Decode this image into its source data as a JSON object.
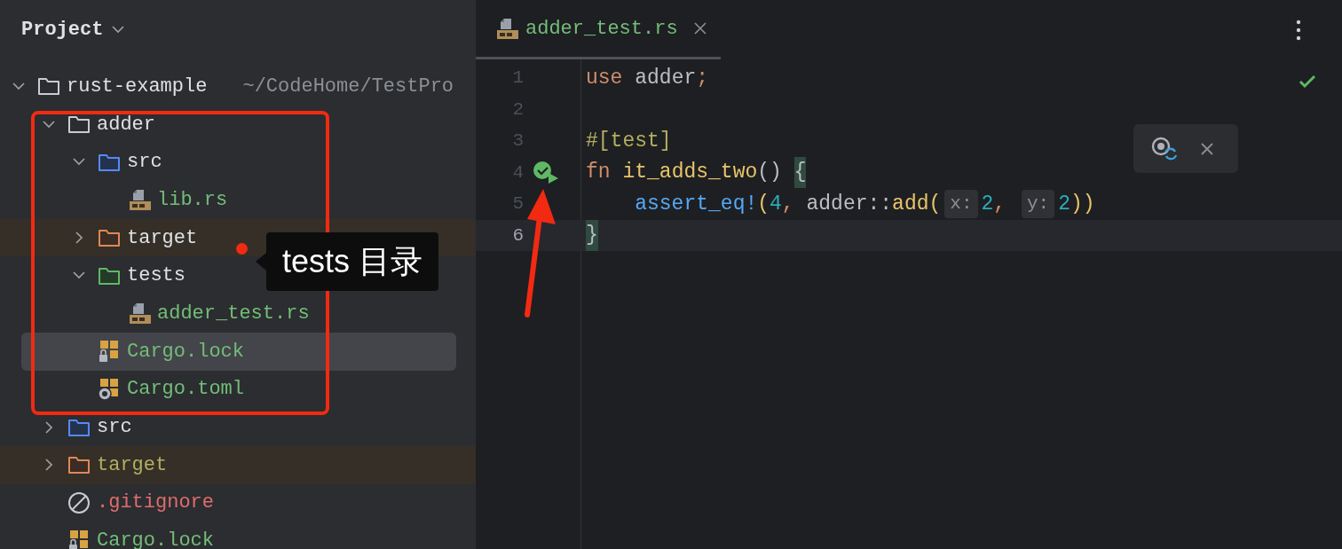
{
  "project_panel": {
    "title": "Project",
    "tree": [
      {
        "name": "rust-example",
        "kind": "folder",
        "color": "#dfe1e5",
        "path": "~/CodeHome/TestPro",
        "expanded": true,
        "selected": false,
        "excluded": false,
        "children": [
          {
            "name": "adder",
            "kind": "folder",
            "color": "#dfe1e5",
            "expanded": true,
            "selected": false,
            "excluded": false,
            "children": [
              {
                "name": "src",
                "kind": "source_folder",
                "color": "#dfe1e5",
                "expanded": true,
                "selected": false,
                "excluded": false,
                "children": [
                  {
                    "name": "lib.rs",
                    "kind": "rs_file",
                    "color": "#73bd79",
                    "selected": false,
                    "excluded": false
                  }
                ]
              },
              {
                "name": "target",
                "kind": "excluded_folder",
                "color": "#dfe1e5",
                "expanded": false,
                "selected": false,
                "excluded": true
              },
              {
                "name": "tests",
                "kind": "test_folder",
                "color": "#dfe1e5",
                "expanded": true,
                "selected": false,
                "excluded": false,
                "children": [
                  {
                    "name": "adder_test.rs",
                    "kind": "rs_file",
                    "color": "#73bd79",
                    "selected": false,
                    "excluded": false
                  }
                ]
              },
              {
                "name": "Cargo.lock",
                "kind": "cargo_lock",
                "color": "#73bd79",
                "selected": true,
                "excluded": false
              },
              {
                "name": "Cargo.toml",
                "kind": "cargo_toml",
                "color": "#73bd79",
                "selected": false,
                "excluded": false
              }
            ]
          },
          {
            "name": "src",
            "kind": "source_folder",
            "color": "#dfe1e5",
            "expanded": false,
            "selected": false,
            "excluded": false
          },
          {
            "name": "target",
            "kind": "excluded_folder",
            "color": "#b3ae60",
            "expanded": false,
            "selected": false,
            "excluded": true
          },
          {
            "name": ".gitignore",
            "kind": "ignore_file",
            "color": "#e06c6c",
            "selected": false,
            "excluded": false
          },
          {
            "name": "Cargo.lock",
            "kind": "cargo_lock",
            "color": "#73bd79",
            "selected": false,
            "excluded": false
          }
        ]
      }
    ]
  },
  "annotation": {
    "label": "tests 目录"
  },
  "editor": {
    "tab": {
      "label": "adder_test.rs",
      "selected": true
    },
    "lines": [
      {
        "number": "1",
        "current": false,
        "run_marker": false,
        "tokens": [
          {
            "text": "use ",
            "kind": "keyword"
          },
          {
            "text": "adder",
            "kind": "ident"
          },
          {
            "text": ";",
            "kind": "keyword"
          }
        ]
      },
      {
        "number": "2",
        "current": false,
        "run_marker": false
      },
      {
        "number": "3",
        "current": false,
        "run_marker": false,
        "tokens": [
          {
            "text": "#[test]",
            "kind": "attr"
          }
        ]
      },
      {
        "number": "4",
        "current": false,
        "run_marker": true,
        "tokens": [
          {
            "text": "fn ",
            "kind": "keyword"
          },
          {
            "text": "it_adds_two",
            "kind": "fn_name"
          },
          {
            "text": "() ",
            "kind": "ident"
          },
          {
            "text": "{",
            "kind": "brace_match"
          }
        ]
      },
      {
        "number": "5",
        "current": false,
        "run_marker": false,
        "tokens": [
          {
            "text": "    assert_eq!",
            "kind": "macro"
          },
          {
            "text": "(",
            "kind": "paren"
          },
          {
            "text": "4",
            "kind": "number"
          },
          {
            "text": ", ",
            "kind": "keyword"
          },
          {
            "text": "adder::",
            "kind": "ident"
          },
          {
            "text": "add",
            "kind": "fn_name"
          },
          {
            "text": "(",
            "kind": "paren"
          },
          {
            "text": "x:",
            "kind": "hint"
          },
          {
            "text": "2",
            "kind": "number"
          },
          {
            "text": ", ",
            "kind": "keyword"
          },
          {
            "text": "y:",
            "kind": "hint"
          },
          {
            "text": "2",
            "kind": "number"
          },
          {
            "text": "))",
            "kind": "paren"
          }
        ]
      },
      {
        "number": "6",
        "current": true,
        "run_marker": false,
        "tokens": [
          {
            "text": "}",
            "kind": "brace_match"
          }
        ]
      }
    ]
  }
}
